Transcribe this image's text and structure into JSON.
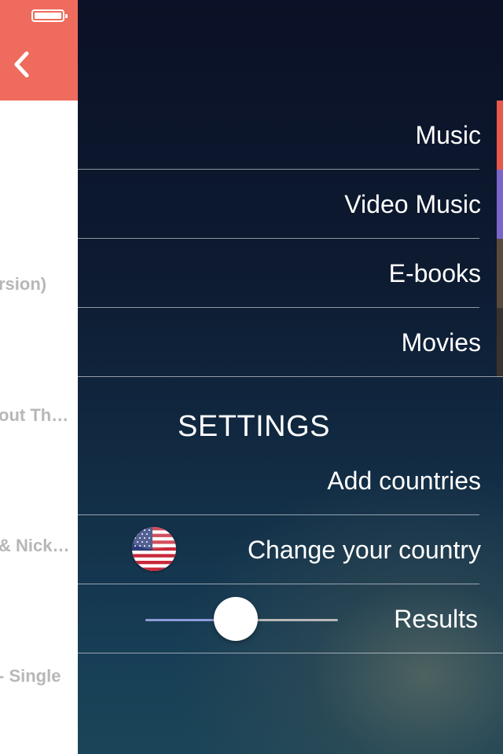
{
  "peek": {
    "lines": [
      "rsion)",
      "out Th…",
      "& Nick…",
      "- Single"
    ]
  },
  "menu": {
    "items": [
      {
        "label": "Music",
        "color": "#e8594c"
      },
      {
        "label": "Video Music",
        "color": "#7a66c9"
      },
      {
        "label": "E-books",
        "color": "#5a4a3c"
      },
      {
        "label": "Movies",
        "color": "#3a3230"
      }
    ]
  },
  "settings": {
    "title": "SETTINGS",
    "add_countries": "Add countries",
    "change_country": "Change your country",
    "results": "Results",
    "results_slider_fraction": 0.47
  },
  "colors": {
    "header_accent": "#ef6b5d"
  },
  "icons": {
    "back": "chevron-left-icon",
    "flag": "us-flag-icon",
    "battery": "battery-icon"
  }
}
